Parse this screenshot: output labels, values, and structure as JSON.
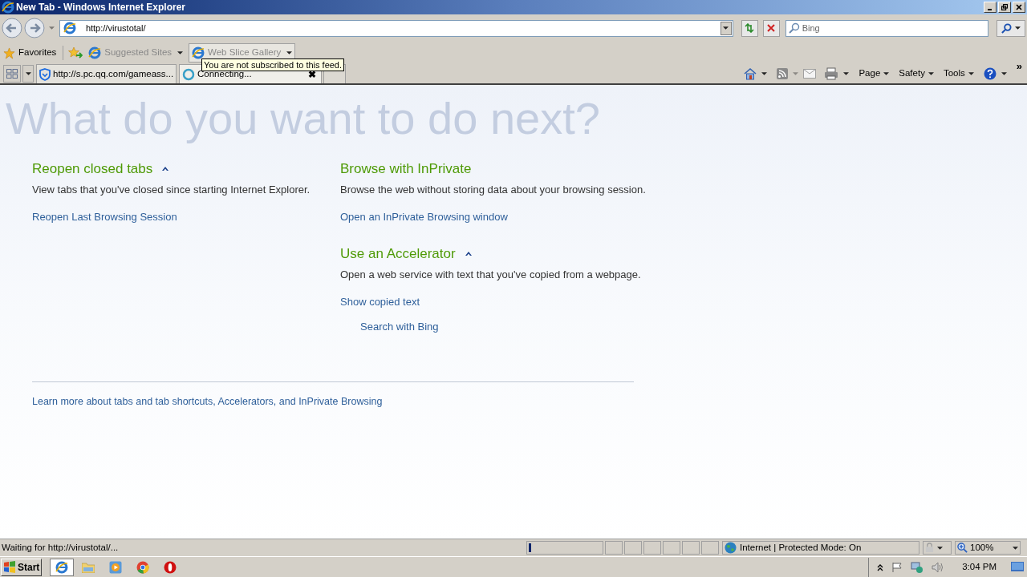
{
  "window": {
    "title": "New Tab - Windows Internet Explorer"
  },
  "address_bar": {
    "value": "http://virustotal/"
  },
  "search": {
    "placeholder": "Bing"
  },
  "favorites_bar": {
    "favorites": "Favorites",
    "items": [
      {
        "label": "Suggested Sites",
        "hovered": false
      },
      {
        "label": "Web Slice Gallery",
        "hovered": true
      }
    ]
  },
  "tooltip": "You are not subscribed to this feed.",
  "tabs": [
    {
      "label": "http://s.pc.qq.com/gameass...",
      "selected": false,
      "kind": "shield"
    },
    {
      "label": "Connecting...",
      "selected": true,
      "kind": "loading"
    }
  ],
  "tab_close": "✖",
  "command_bar": [
    "Page",
    "Safety",
    "Tools"
  ],
  "command_more": "»",
  "page": {
    "heading": "What do you want to do next?",
    "left": [
      {
        "title": "Reopen closed tabs",
        "collapsible": true,
        "text": "View tabs that you've closed since starting Internet Explorer.",
        "links": [
          "Reopen Last Browsing Session"
        ]
      }
    ],
    "right": [
      {
        "title": "Browse with InPrivate",
        "collapsible": false,
        "text": "Browse the web without storing data about your browsing session.",
        "links": [
          "Open an InPrivate Browsing window"
        ]
      },
      {
        "title": "Use an Accelerator",
        "collapsible": true,
        "text": "Open a web service with text that you've copied from a webpage.",
        "links": [
          "Show copied text"
        ],
        "accelerators": [
          "Search with Bing"
        ]
      }
    ],
    "footer_link": "Learn more about tabs and tab shortcuts, Accelerators, and InPrivate Browsing"
  },
  "status_bar": {
    "text": "Waiting for http://virustotal/...",
    "progress": {
      "level": 0.03
    },
    "zone": "Internet | Protected Mode: On",
    "zoom": "100%"
  },
  "taskbar": {
    "start": "Start",
    "clock": "3:04 PM"
  }
}
